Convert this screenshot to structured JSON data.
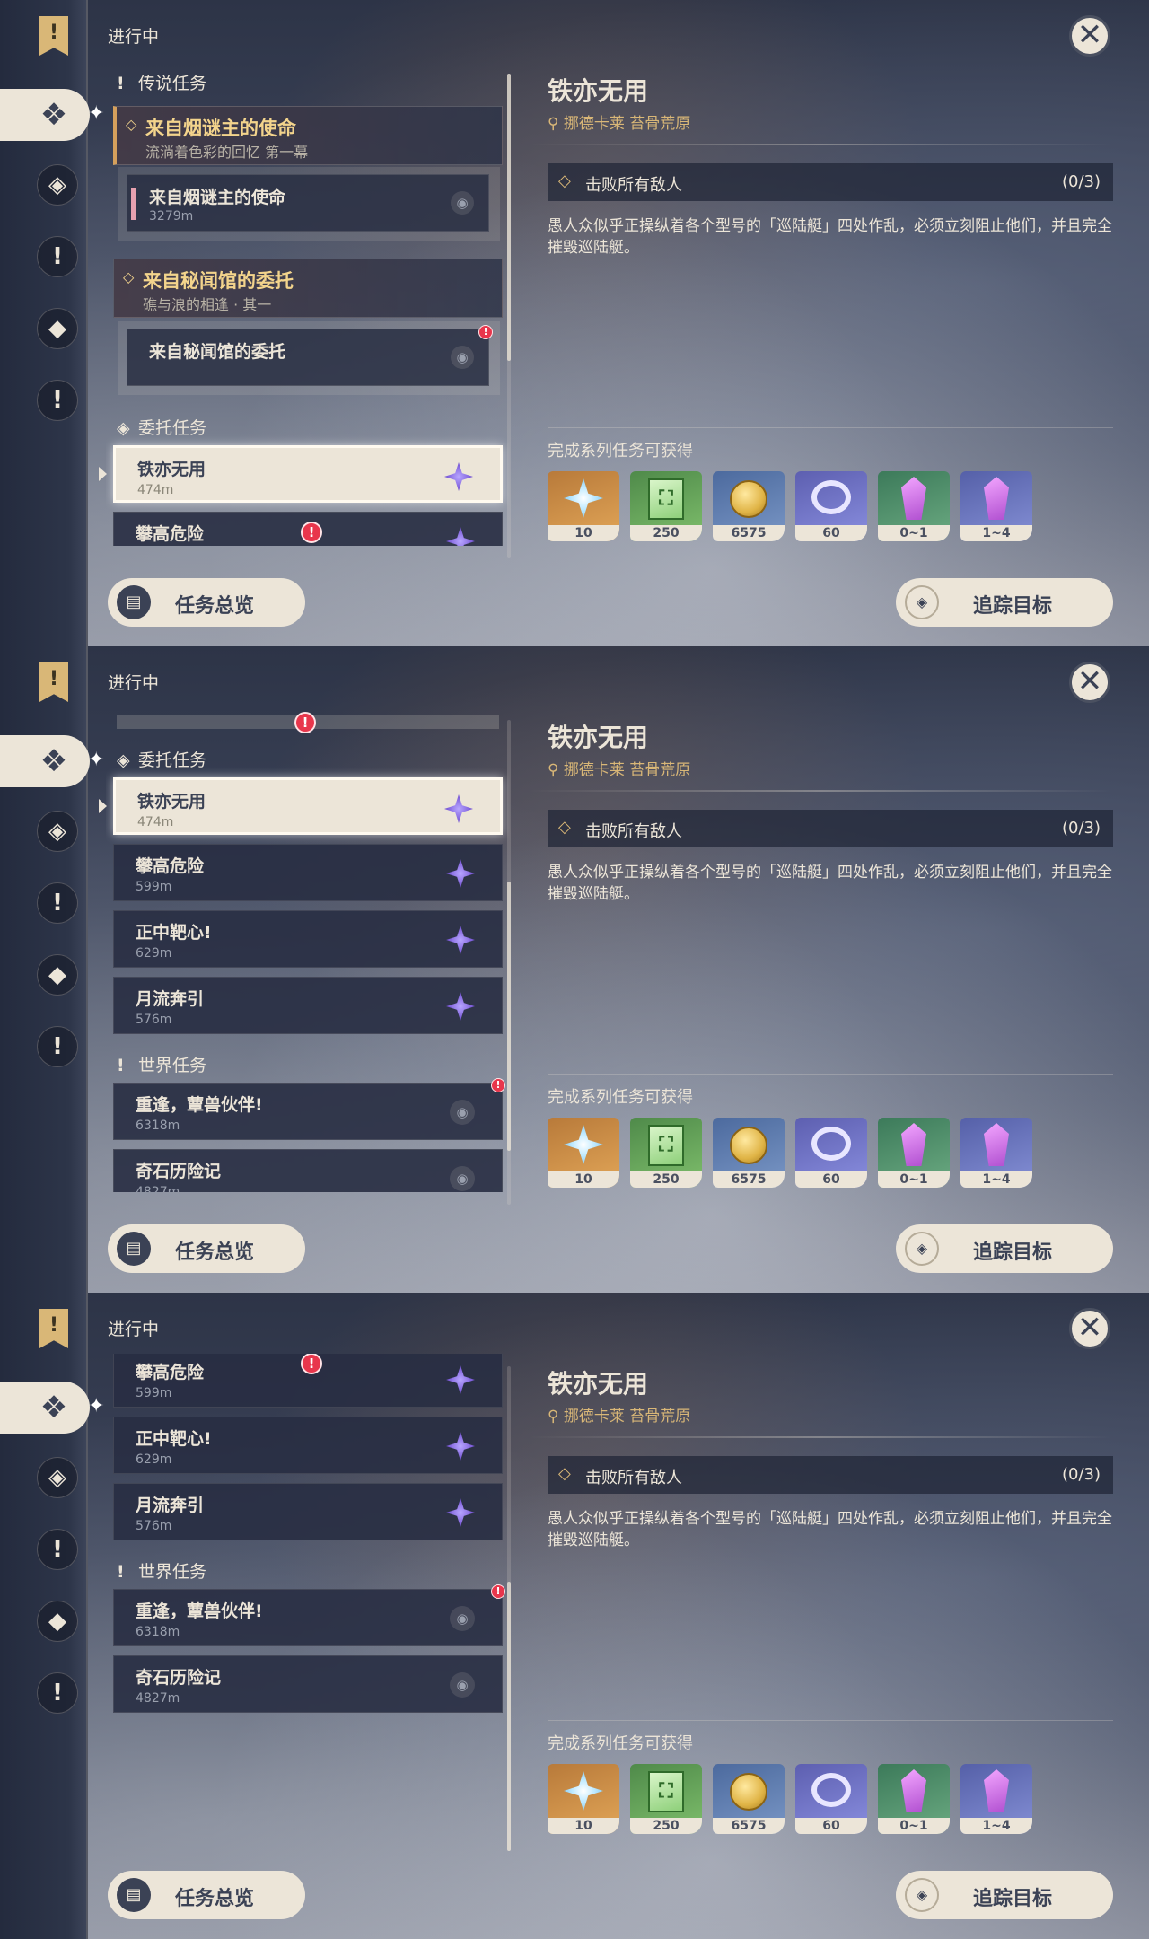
{
  "header": {
    "in_progress_label": "进行中"
  },
  "buttons": {
    "overview_label": "任务总览",
    "track_label": "追踪目标"
  },
  "sections": {
    "legend": "传说任务",
    "commission": "委托任务",
    "world": "世界任务"
  },
  "groups": {
    "archon": {
      "title": "来自烟谜主的使命",
      "subtitle": "流淌着色彩的回忆  第一幕",
      "item_title": "来自烟谜主的使命",
      "item_distance": "3279m"
    },
    "hangout": {
      "title": "来自秘闻馆的委托",
      "subtitle": "礁与浪的相逢 · 其一",
      "item_title": "来自秘闻馆的委托"
    }
  },
  "commissions": [
    {
      "title": "铁亦无用",
      "distance": "474m"
    },
    {
      "title": "攀高危险",
      "distance": "599m"
    },
    {
      "title": "正中靶心!",
      "distance": "629m"
    },
    {
      "title": "月流奔引",
      "distance": "576m"
    }
  ],
  "world_quests": [
    {
      "title": "重逢，蕈兽伙伴!",
      "distance": "6318m"
    },
    {
      "title": "奇石历险记",
      "distance": "4827m"
    }
  ],
  "detail": {
    "title": "铁亦无用",
    "location": "挪德卡莱  苔骨荒原",
    "objective": "击败所有敌人",
    "objective_count": "(0/3)",
    "description": "愚人众似乎正操纵着各个型号的「巡陆艇」四处作乱，必须立刻阻止他们，并且完全摧毁巡陆艇。",
    "rewards_label": "完成系列任务可获得",
    "rewards": [
      {
        "icon": "primogem-icon",
        "amount": "10"
      },
      {
        "icon": "adventure-exp-icon",
        "amount": "250"
      },
      {
        "icon": "mora-icon",
        "amount": "6575"
      },
      {
        "icon": "companionship-exp-icon",
        "amount": "60"
      },
      {
        "icon": "crystal-chunk-icon",
        "amount": "0~1"
      },
      {
        "icon": "crystal-cluster-icon",
        "amount": "1~4"
      }
    ]
  },
  "colors": {
    "accent_gold": "#d9b777",
    "cream": "#ece5d8",
    "alert_red": "#e8364c",
    "panel_dark": "#283042"
  }
}
